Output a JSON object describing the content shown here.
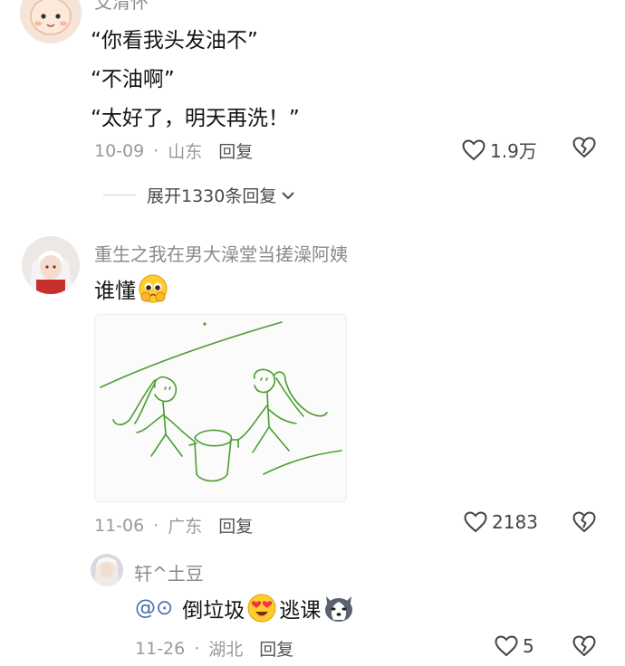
{
  "comment1": {
    "name": "艾清怀",
    "lines": [
      "“你看我头发油不”",
      "“不油啊”",
      "“太好了，明天再洗！”"
    ],
    "date": "10-09",
    "location": "山东",
    "reply_label": "回复",
    "likes": "1.9万",
    "expand_label": "展开1330条回复"
  },
  "comment2": {
    "name": "重生之我在男大澡堂当搓澡阿姨",
    "text": "谁懂",
    "date": "11-06",
    "location": "广东",
    "reply_label": "回复",
    "likes": "2183"
  },
  "reply1": {
    "name": "轩^土豆",
    "mention": "@⊙",
    "text_a": "倒垃圾",
    "text_b": "逃课",
    "date": "11-26",
    "location": "湖北",
    "reply_label": "回复",
    "likes": "5"
  },
  "colors": {
    "drawing_stroke": "#4a9e2f",
    "text_primary": "#141414",
    "text_secondary": "#8a8a8a"
  }
}
